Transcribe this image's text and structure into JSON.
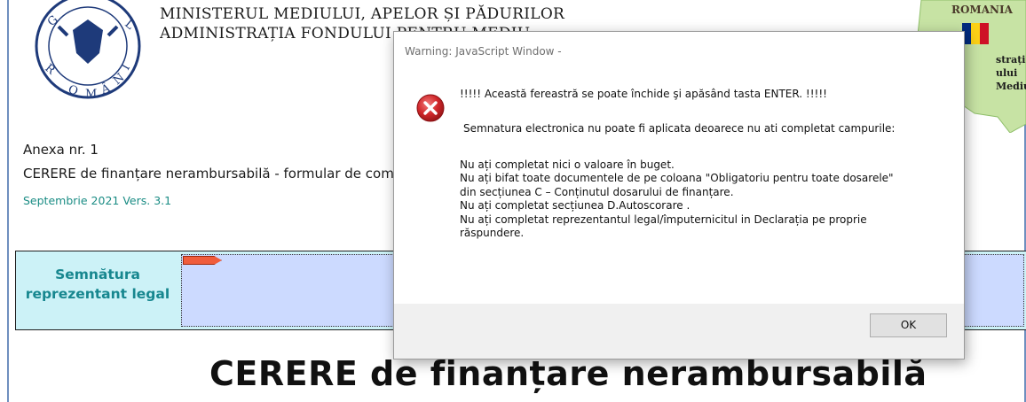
{
  "header": {
    "ministry_line1": "MINISTERUL MEDIULUI, APELOR ȘI PĂDURILOR",
    "ministry_line2": "ADMINISTRAȚIA FONDULUI PENTRU MEDIU",
    "crest_alt": "GUVERNUL ROMÂNIEI"
  },
  "map_logo": {
    "country": "ROMANIA",
    "side_lines": [
      "strația",
      "ului",
      "Mediu"
    ],
    "flag_colors": [
      "#002b7f",
      "#fcd116",
      "#ce1126"
    ]
  },
  "document": {
    "anexa": "Anexa nr. 1",
    "cerere_line": "CERERE de finanțare nerambursabilă - formular de completat online",
    "version": "Septembrie 2021  Vers.   3.1",
    "signature_label": "Semnătura reprezentant legal",
    "big_title": "CERERE de finanțare nerambursabilă"
  },
  "dialog": {
    "title": "Warning: JavaScript Window -",
    "icon": "error-icon",
    "message_first": "!!!!! Această fereastră se poate închide şi apăsând tasta ENTER. !!!!!",
    "message_second": "Semnatura electronica nu poate fi aplicata deoarece nu ati completat campurile:",
    "lines": [
      "Nu ați completat nici o valoare în buget.",
      "Nu ați bifat toate documentele de pe coloana \"Obligatoriu pentru toate dosarele\"",
      "din secțiunea C – Conținutul dosarului de finanțare.",
      "Nu ați completat secțiunea D.Autoscorare .",
      "Nu ați completat reprezentantul legal/împuternicitul in Declarația pe proprie",
      "răspundere."
    ],
    "ok_label": "OK"
  },
  "colors": {
    "accent_teal": "#17878f",
    "signature_field": "#ccdaff",
    "signature_box": "#ccf2f7",
    "error_red": "#d0272a"
  }
}
